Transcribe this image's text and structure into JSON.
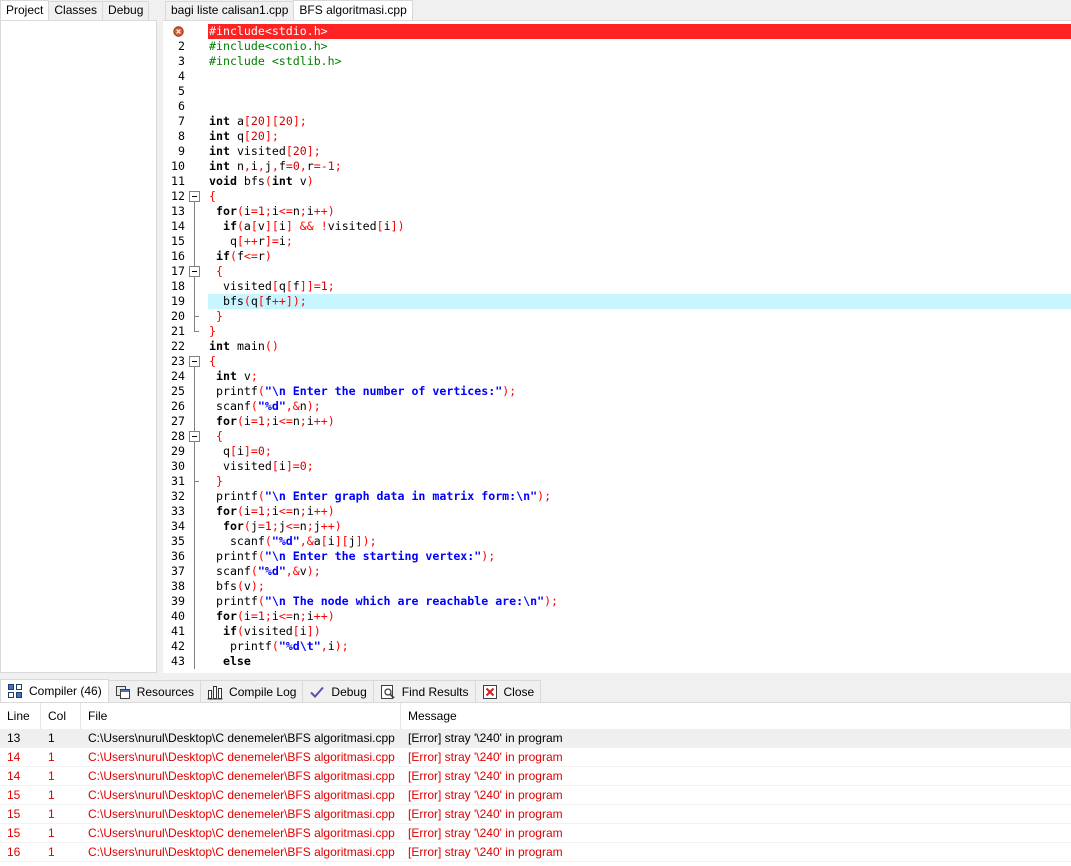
{
  "left_panel": {
    "tabs": [
      {
        "label": "Project",
        "active": true
      },
      {
        "label": "Classes"
      },
      {
        "label": "Debug"
      }
    ]
  },
  "editor": {
    "tabs": [
      {
        "label": "bagi liste calisan1.cpp"
      },
      {
        "label": "BFS algoritmasi.cpp",
        "active": true
      }
    ],
    "lines": [
      {
        "marker": "error-marker-icon",
        "code": "#include<stdio.h>",
        "state": "error"
      },
      {
        "num": "2",
        "code": "#include<conio.h>"
      },
      {
        "num": "3",
        "code": "#include <stdlib.h>"
      },
      {
        "num": "4",
        "code": ""
      },
      {
        "num": "5",
        "code": ""
      },
      {
        "num": "6",
        "code": ""
      },
      {
        "num": "7",
        "code": "int a[20][20];"
      },
      {
        "num": "8",
        "code": "int q[20];"
      },
      {
        "num": "9",
        "code": "int visited[20];"
      },
      {
        "num": "10",
        "code": "int n,i,j,f=0,r=-1;"
      },
      {
        "num": "11",
        "code": "void bfs(int v)"
      },
      {
        "num": "12",
        "code": "{",
        "fold": "box"
      },
      {
        "num": "13",
        "code": " for(i=1;i<=n;i++)",
        "fold": "bar"
      },
      {
        "num": "14",
        "code": "  if(a[v][i] && !visited[i])",
        "fold": "bar"
      },
      {
        "num": "15",
        "code": "   q[++r]=i;",
        "fold": "bar"
      },
      {
        "num": "16",
        "code": " if(f<=r)",
        "fold": "bar"
      },
      {
        "num": "17",
        "code": " {",
        "fold": "box-nested"
      },
      {
        "num": "18",
        "code": "  visited[q[f]]=1;",
        "fold": "bar"
      },
      {
        "num": "19",
        "code": "  bfs(q[f++]);",
        "fold": "bar",
        "state": "active"
      },
      {
        "num": "20",
        "code": " }",
        "fold": "end-nested"
      },
      {
        "num": "21",
        "code": "}",
        "fold": "end"
      },
      {
        "num": "22",
        "code": "int main()"
      },
      {
        "num": "23",
        "code": "{",
        "fold": "box"
      },
      {
        "num": "24",
        "code": " int v;",
        "fold": "bar"
      },
      {
        "num": "25",
        "code": " printf(\"\\n Enter the number of vertices:\");",
        "fold": "bar"
      },
      {
        "num": "26",
        "code": " scanf(\"%d\",&n);",
        "fold": "bar"
      },
      {
        "num": "27",
        "code": " for(i=1;i<=n;i++)",
        "fold": "bar"
      },
      {
        "num": "28",
        "code": " {",
        "fold": "box-nested"
      },
      {
        "num": "29",
        "code": "  q[i]=0;",
        "fold": "bar"
      },
      {
        "num": "30",
        "code": "  visited[i]=0;",
        "fold": "bar"
      },
      {
        "num": "31",
        "code": " }",
        "fold": "end-nested"
      },
      {
        "num": "32",
        "code": " printf(\"\\n Enter graph data in matrix form:\\n\");",
        "fold": "bar"
      },
      {
        "num": "33",
        "code": " for(i=1;i<=n;i++)",
        "fold": "bar"
      },
      {
        "num": "34",
        "code": "  for(j=1;j<=n;j++)",
        "fold": "bar"
      },
      {
        "num": "35",
        "code": "   scanf(\"%d\",&a[i][j]);",
        "fold": "bar"
      },
      {
        "num": "36",
        "code": " printf(\"\\n Enter the starting vertex:\");",
        "fold": "bar"
      },
      {
        "num": "37",
        "code": " scanf(\"%d\",&v);",
        "fold": "bar"
      },
      {
        "num": "38",
        "code": " bfs(v);",
        "fold": "bar"
      },
      {
        "num": "39",
        "code": " printf(\"\\n The node which are reachable are:\\n\");",
        "fold": "bar"
      },
      {
        "num": "40",
        "code": " for(i=1;i<=n;i++)",
        "fold": "bar"
      },
      {
        "num": "41",
        "code": "  if(visited[i])",
        "fold": "bar"
      },
      {
        "num": "42",
        "code": "   printf(\"%d\\t\",i);",
        "fold": "bar"
      },
      {
        "num": "43",
        "code": "  else",
        "fold": "bar"
      }
    ]
  },
  "bottom_panel": {
    "tabs": [
      {
        "label": "Compiler (46)",
        "icon": "compiler-icon",
        "active": true
      },
      {
        "label": "Resources",
        "icon": "resources-icon"
      },
      {
        "label": "Compile Log",
        "icon": "compile-log-icon"
      },
      {
        "label": "Debug",
        "icon": "debug-icon"
      },
      {
        "label": "Find Results",
        "icon": "find-results-icon"
      },
      {
        "label": "Close",
        "icon": "close-icon"
      }
    ],
    "columns": [
      "Line",
      "Col",
      "File",
      "Message"
    ],
    "rows": [
      {
        "line": "13",
        "col": "1",
        "file": "C:\\Users\\nurul\\Desktop\\C denemeler\\BFS algoritmasi.cpp",
        "message": "[Error] stray '\\240' in program",
        "selected": true
      },
      {
        "line": "14",
        "col": "1",
        "file": "C:\\Users\\nurul\\Desktop\\C denemeler\\BFS algoritmasi.cpp",
        "message": "[Error] stray '\\240' in program"
      },
      {
        "line": "14",
        "col": "1",
        "file": "C:\\Users\\nurul\\Desktop\\C denemeler\\BFS algoritmasi.cpp",
        "message": "[Error] stray '\\240' in program"
      },
      {
        "line": "15",
        "col": "1",
        "file": "C:\\Users\\nurul\\Desktop\\C denemeler\\BFS algoritmasi.cpp",
        "message": "[Error] stray '\\240' in program"
      },
      {
        "line": "15",
        "col": "1",
        "file": "C:\\Users\\nurul\\Desktop\\C denemeler\\BFS algoritmasi.cpp",
        "message": "[Error] stray '\\240' in program"
      },
      {
        "line": "15",
        "col": "1",
        "file": "C:\\Users\\nurul\\Desktop\\C denemeler\\BFS algoritmasi.cpp",
        "message": "[Error] stray '\\240' in program"
      },
      {
        "line": "16",
        "col": "1",
        "file": "C:\\Users\\nurul\\Desktop\\C denemeler\\BFS algoritmasi.cpp",
        "message": "[Error] stray '\\240' in program"
      }
    ]
  },
  "colors": {
    "error_line": "#FF2222",
    "active_line": "#C8F6FF",
    "error_text": "#E00000"
  }
}
